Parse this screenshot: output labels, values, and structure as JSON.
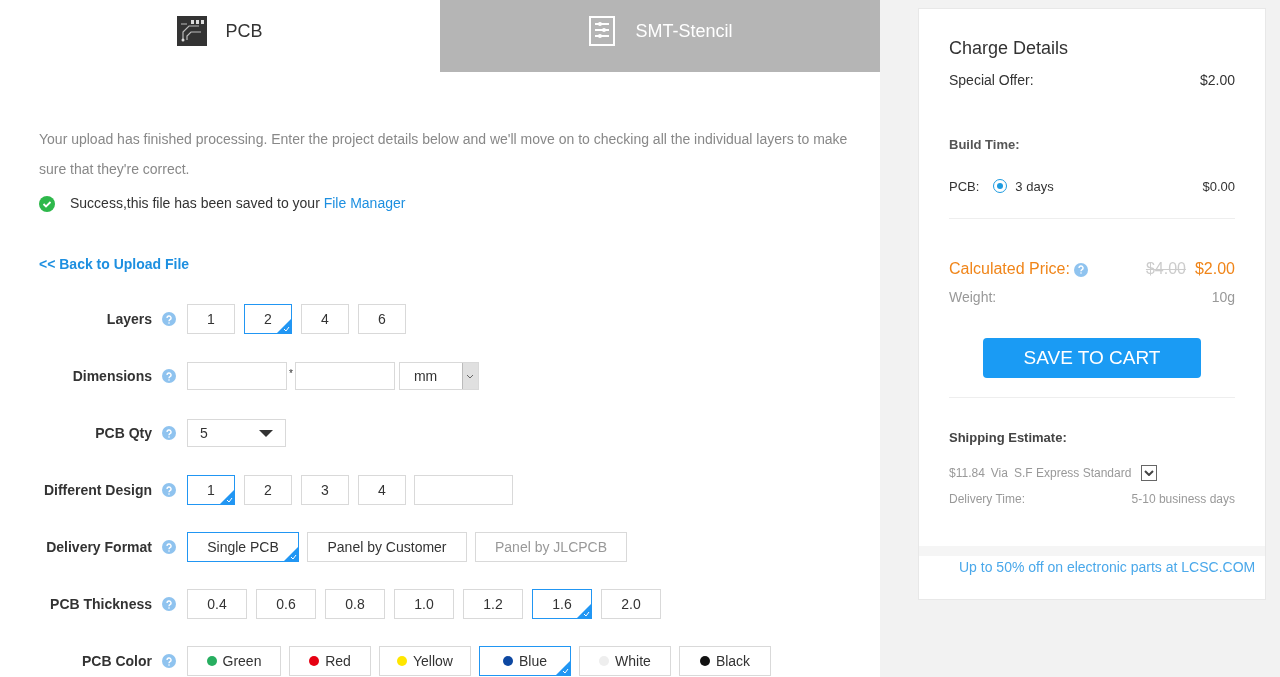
{
  "tabs": [
    {
      "label": "PCB",
      "selected": true
    },
    {
      "label": "SMT-Stencil",
      "selected": false
    }
  ],
  "intro": "Your upload has finished processing. Enter the project details below and we'll move on to checking all the individual layers to make sure that they're correct.",
  "success": {
    "text": "Success,this file has been saved to your",
    "link": "File Manager"
  },
  "back_link": "<< Back to Upload File",
  "fields": [
    {
      "label": "Layers",
      "kind": "buttons",
      "options": [
        {
          "label": "1",
          "selected": false,
          "disabled": false
        },
        {
          "label": "2",
          "selected": true,
          "disabled": false
        },
        {
          "label": "4",
          "selected": false,
          "disabled": false
        },
        {
          "label": "6",
          "selected": false,
          "disabled": false
        }
      ]
    },
    {
      "label": "Dimensions",
      "kind": "dimensions",
      "separator": "*",
      "unit": "mm"
    },
    {
      "label": "PCB Qty",
      "kind": "select",
      "value": "5"
    },
    {
      "label": "Different Design",
      "kind": "buttons",
      "extra_input": true,
      "options": [
        {
          "label": "1",
          "selected": true,
          "disabled": false
        },
        {
          "label": "2",
          "selected": false,
          "disabled": false
        },
        {
          "label": "3",
          "selected": false,
          "disabled": false
        },
        {
          "label": "4",
          "selected": false,
          "disabled": false
        }
      ]
    },
    {
      "label": "Delivery Format",
      "kind": "buttons",
      "options": [
        {
          "label": "Single PCB",
          "selected": true,
          "disabled": false
        },
        {
          "label": "Panel by Customer",
          "selected": false,
          "disabled": false
        },
        {
          "label": "Panel by JLCPCB",
          "selected": false,
          "disabled": true
        }
      ]
    },
    {
      "label": "PCB Thickness",
      "kind": "buttons",
      "options": [
        {
          "label": "0.4",
          "selected": false,
          "disabled": false
        },
        {
          "label": "0.6",
          "selected": false,
          "disabled": false
        },
        {
          "label": "0.8",
          "selected": false,
          "disabled": false
        },
        {
          "label": "1.0",
          "selected": false,
          "disabled": false
        },
        {
          "label": "1.2",
          "selected": false,
          "disabled": false
        },
        {
          "label": "1.6",
          "selected": true,
          "disabled": false
        },
        {
          "label": "2.0",
          "selected": false,
          "disabled": false
        }
      ]
    },
    {
      "label": "PCB Color",
      "kind": "colors",
      "options": [
        {
          "label": "Green",
          "selected": false,
          "disabled": false,
          "color": "#27ae60"
        },
        {
          "label": "Red",
          "selected": false,
          "disabled": false,
          "color": "#e60012"
        },
        {
          "label": "Yellow",
          "selected": false,
          "disabled": false,
          "color": "#ffe600"
        },
        {
          "label": "Blue",
          "selected": true,
          "disabled": false,
          "color": "#0d47a1"
        },
        {
          "label": "White",
          "selected": false,
          "disabled": false,
          "color": "#eeeeee"
        },
        {
          "label": "Black",
          "selected": false,
          "disabled": false,
          "color": "#111111"
        }
      ]
    }
  ],
  "charge": {
    "title": "Charge Details",
    "special_offer": {
      "label": "Special Offer:",
      "value": "$2.00"
    },
    "build_time": {
      "label": "Build Time:",
      "item": "PCB:",
      "option": "3 days",
      "selected": true,
      "value": "$0.00"
    },
    "calculated": {
      "label": "Calculated Price:",
      "old": "$4.00",
      "value": "$2.00"
    },
    "weight": {
      "label": "Weight:",
      "value": "10g"
    },
    "button": "SAVE TO CART",
    "shipping": {
      "label": "Shipping Estimate:",
      "price": "$11.84",
      "via": "Via",
      "method": "S.F Express Standard",
      "delivery_label": "Delivery Time:",
      "delivery_value": "5-10 business days"
    },
    "promo": "Up to 50% off on electronic parts at LCSC.COM"
  }
}
